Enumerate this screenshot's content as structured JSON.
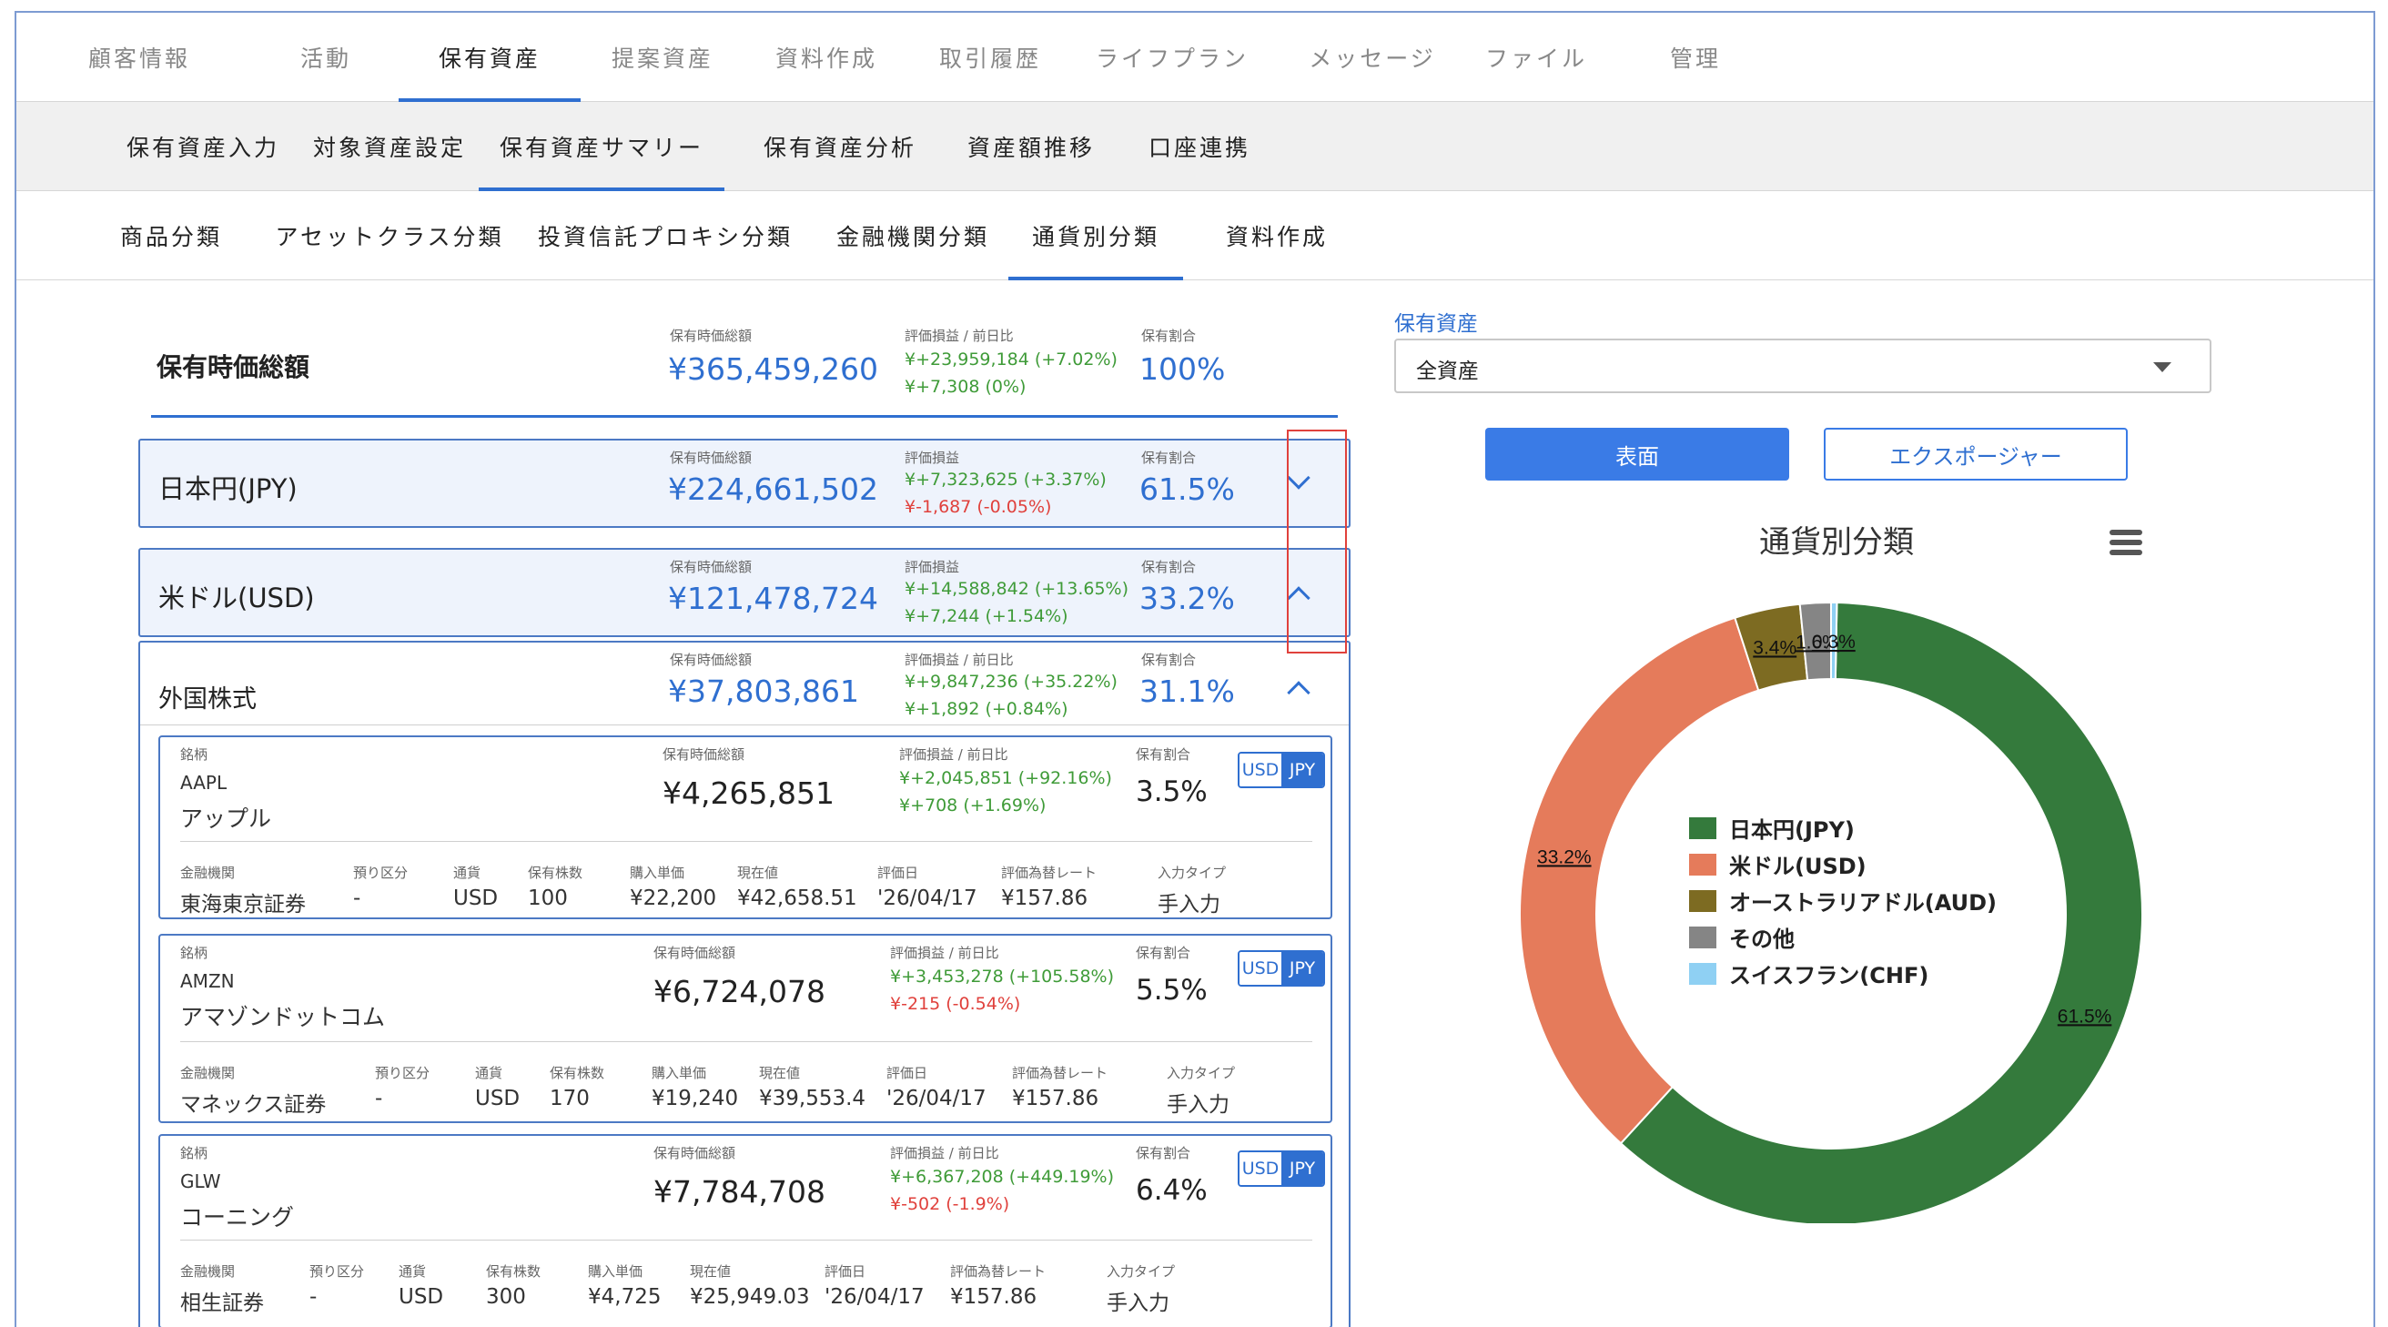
{
  "nav": {
    "top_tabs": [
      "顧客情報",
      "活動",
      "保有資産",
      "提案資産",
      "資料作成",
      "取引履歴",
      "ライフプラン",
      "メッセージ",
      "ファイル",
      "管理"
    ],
    "sub_tabs": [
      "保有資産入力",
      "対象資産設定",
      "保有資産サマリー",
      "保有資産分析",
      "資産額推移",
      "口座連携"
    ],
    "third_tabs": [
      "商品分類",
      "アセットクラス分類",
      "投資信託プロキシ分類",
      "金融機関分類",
      "通貨別分類",
      "資料作成"
    ]
  },
  "summary": {
    "title": "保有時価総額",
    "value_label": "保有時価総額",
    "value": "¥365,459,260",
    "pl_label": "評価損益 / 前日比",
    "pl": "¥+23,959,184 (+7.02%)",
    "daily": "¥+7,308 (0%)",
    "ratio_label": "保有割合",
    "ratio": "100%"
  },
  "groups": [
    {
      "name": "日本円(JPY)",
      "value_label": "保有時価総額",
      "value": "¥224,661,502",
      "pl_label": "評価損益",
      "pl": "¥+7,323,625 (+3.37%)",
      "daily": "¥-1,687 (-0.05%)",
      "ratio_label": "保有割合",
      "ratio": "61.5%"
    },
    {
      "name": "米ドル(USD)",
      "value_label": "保有時価総額",
      "value": "¥121,478,724",
      "pl_label": "評価損益",
      "pl": "¥+14,588,842 (+13.65%)",
      "daily": "¥+7,244 (+1.54%)",
      "ratio_label": "保有割合",
      "ratio": "33.2%"
    },
    {
      "name": "外国株式",
      "value_label": "保有時価総額",
      "value": "¥37,803,861",
      "pl_label": "評価損益 / 前日比",
      "pl": "¥+9,847,236 (+35.22%)",
      "daily": "¥+1,892 (+0.84%)",
      "ratio_label": "保有割合",
      "ratio": "31.1%"
    }
  ],
  "holding_labels": {
    "brand": "銘柄",
    "value": "保有時価総額",
    "pl": "評価損益 / 前日比",
    "ratio": "保有割合",
    "inst": "金融機関",
    "deposit": "預り区分",
    "currency": "通貨",
    "shares": "保有株数",
    "buy": "購入単価",
    "current": "現在値",
    "date": "評価日",
    "fx": "評価為替レート",
    "input": "入力タイプ",
    "usd": "USD",
    "jpy": "JPY"
  },
  "holdings": [
    {
      "ticker": "AAPL",
      "name": "アップル",
      "value": "¥4,265,851",
      "pl": "¥+2,045,851 (+92.16%)",
      "daily": "¥+708 (+1.69%)",
      "ratio": "3.5%",
      "inst": "東海東京証券",
      "deposit": "-",
      "currency": "USD",
      "shares": "100",
      "buy": "¥22,200",
      "current": "¥42,658.51",
      "date": "'26/04/17",
      "fx": "¥157.86",
      "input": "手入力"
    },
    {
      "ticker": "AMZN",
      "name": "アマゾンドットコム",
      "value": "¥6,724,078",
      "pl": "¥+3,453,278 (+105.58%)",
      "daily": "¥-215 (-0.54%)",
      "ratio": "5.5%",
      "inst": "マネックス証券",
      "deposit": "-",
      "currency": "USD",
      "shares": "170",
      "buy": "¥19,240",
      "current": "¥39,553.4",
      "date": "'26/04/17",
      "fx": "¥157.86",
      "input": "手入力"
    },
    {
      "ticker": "GLW",
      "name": "コーニング",
      "value": "¥7,784,708",
      "pl": "¥+6,367,208 (+449.19%)",
      "daily": "¥-502 (-1.9%)",
      "ratio": "6.4%",
      "inst": "相生証券",
      "deposit": "-",
      "currency": "USD",
      "shares": "300",
      "buy": "¥4,725",
      "current": "¥25,949.03",
      "date": "'26/04/17",
      "fx": "¥157.86",
      "input": "手入力"
    }
  ],
  "right": {
    "select_label": "保有資産",
    "select_value": "全資産",
    "btn_primary": "表面",
    "btn_secondary": "エクスポージャー"
  },
  "colors": {
    "accent": "#2f6fd0",
    "positive": "#3f9b38",
    "negative": "#e0413c"
  },
  "chart_data": {
    "type": "pie",
    "title": "通貨別分類",
    "donut": true,
    "legend_position": "center",
    "slices": [
      {
        "name": "日本円(JPY)",
        "value": 61.5,
        "label": "61.5%",
        "color": "#347a3c"
      },
      {
        "name": "米ドル(USD)",
        "value": 33.2,
        "label": "33.2%",
        "color": "#e57b5b"
      },
      {
        "name": "オーストラリアドル(AUD)",
        "value": 3.4,
        "label": "3.4%",
        "color": "#7d6b22"
      },
      {
        "name": "その他",
        "value": 1.6,
        "label": "1.6%",
        "color": "#858585"
      },
      {
        "name": "スイスフラン(CHF)",
        "value": 0.3,
        "label": "0.3%",
        "color": "#8fd0f3"
      }
    ]
  }
}
